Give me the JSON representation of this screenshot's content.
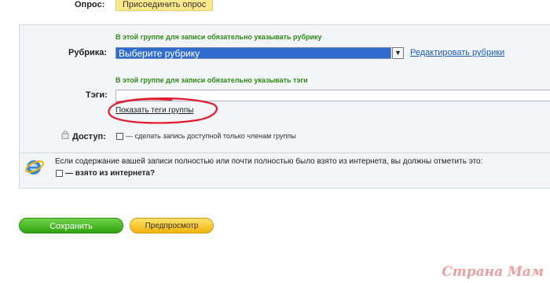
{
  "poll": {
    "label": "Опрос:",
    "attach_button": "Присоединить опрос"
  },
  "rubric": {
    "hint": "В этой группе для записи обязательно указывать рубрику",
    "label": "Рубрика:",
    "selected": "Выберите рубрику",
    "edit_link": "Редактировать рубрики"
  },
  "tags": {
    "hint": "В этой группе для записи обязательно указывать тэги",
    "label": "Тэги:",
    "value": "",
    "show_group_tags": "Показать теги группы"
  },
  "access": {
    "label": "Доступ:",
    "checkbox_text": "— сделать запись доступной только членам группы"
  },
  "internet": {
    "notice": "Если содержание вашей записи полностью или почти полностью было взято из интернета, вы должны отметить это:",
    "checkbox_text": "— взято из интернета?"
  },
  "actions": {
    "save": "Сохранить",
    "preview": "Предпросмотр"
  },
  "watermark": "Страна Мам",
  "colors": {
    "hint_green": "#2b8a14",
    "link_blue": "#1a5bb8",
    "select_blue": "#2f6ccb",
    "annotation_red": "#e0192b"
  }
}
